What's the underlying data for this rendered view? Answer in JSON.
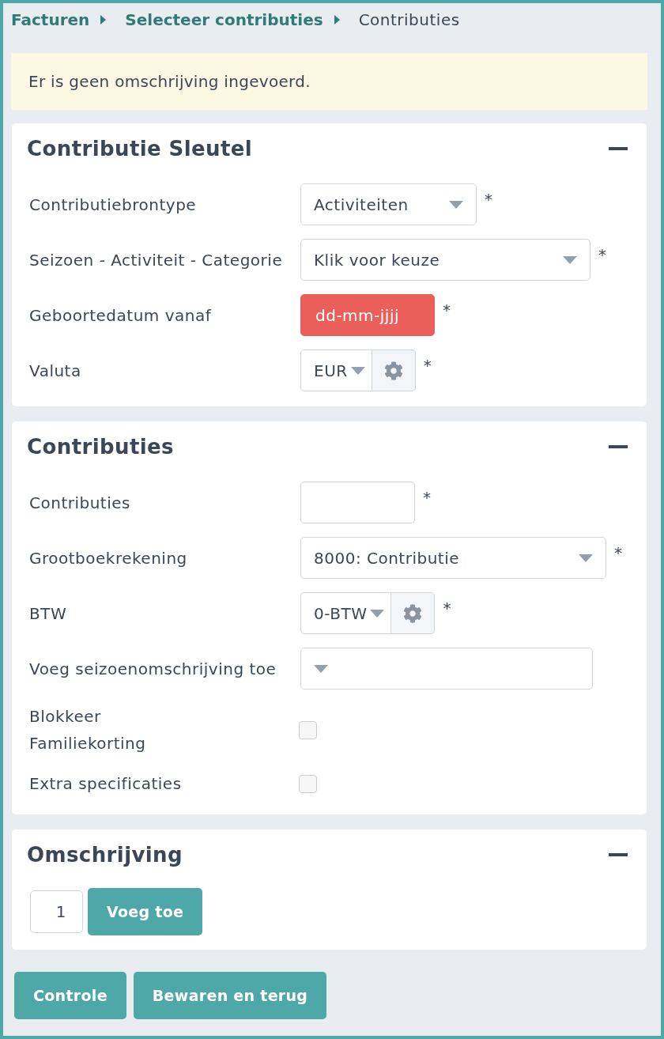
{
  "breadcrumb": [
    {
      "label": "Facturen",
      "kind": "link"
    },
    {
      "label": "Selecteer contributies",
      "kind": "link"
    },
    {
      "label": "Contributies",
      "kind": "current"
    }
  ],
  "alert": {
    "text": "Er is geen omschrijving ingevoerd."
  },
  "sections": [
    {
      "title": "Contributie Sleutel",
      "expanded": true,
      "fields": [
        {
          "label": "Contributiebrontype",
          "kind": "select",
          "value": "Activiteiten",
          "required_mark": "*"
        },
        {
          "label": "Seizoen - Activiteit - Categorie",
          "kind": "select",
          "value": "Klik voor keuze",
          "required_mark": "*"
        },
        {
          "label": "Geboortedatum vanaf",
          "kind": "date",
          "placeholder": "dd-mm-jjjj",
          "invalid": true,
          "required_mark": "*"
        },
        {
          "label": "Valuta",
          "kind": "combo",
          "value": "EUR",
          "required_mark": "*"
        }
      ]
    },
    {
      "title": "Contributies",
      "expanded": true,
      "fields": [
        {
          "label": "Contributies",
          "kind": "text",
          "required_mark": "*"
        },
        {
          "label": "Grootboekrekening",
          "kind": "select",
          "value": "8000: Contributie",
          "required_mark": "*"
        },
        {
          "label": "BTW",
          "kind": "combo",
          "value": "0-BTW",
          "required_mark": "*"
        },
        {
          "label": "Voeg seizoenomschrijving toe",
          "kind": "select"
        },
        {
          "label": "Blokkeer Familiekorting",
          "kind": "checkbox",
          "checked": false
        },
        {
          "label": "Extra specificaties",
          "kind": "checkbox",
          "checked": false
        }
      ]
    },
    {
      "title": "Omschrijving",
      "expanded": true,
      "add_row": {
        "count": "1",
        "button": "Voeg toe"
      }
    }
  ],
  "buttons": [
    "Controle",
    "Bewaren en terug"
  ]
}
